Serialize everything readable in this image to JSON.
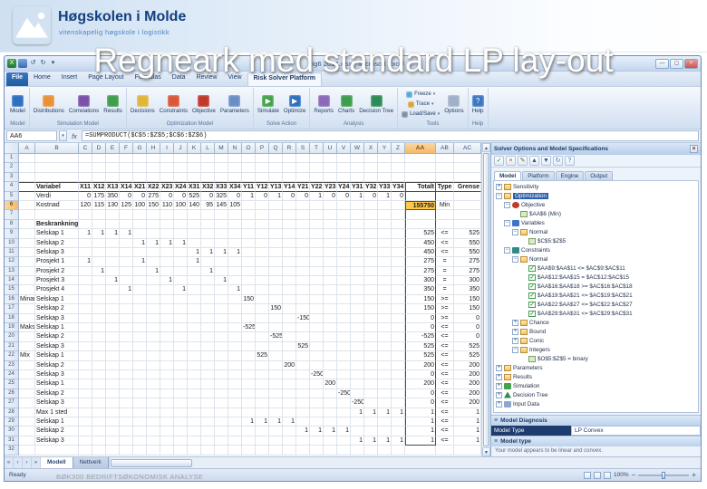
{
  "slide": {
    "title": "Regneark med standard LP lay-out",
    "footer": "BØK300 BEDRIFTSØKONOMISK ANALYSE",
    "logo_title": "Høgskolen i Molde",
    "logo_subtitle": "vitenskapelig høgskole i logistikk"
  },
  "window": {
    "caption": "Fig6 2014.xlsx - Microsoft Excel",
    "name_box": "AA6",
    "formula": "=SUMPRODUCT($C$5:$Z$5;$C$6:$Z$6)",
    "ribbon_tabs": [
      {
        "label": "File",
        "file": true
      },
      {
        "label": "Home"
      },
      {
        "label": "Insert"
      },
      {
        "label": "Page Layout"
      },
      {
        "label": "Formulas"
      },
      {
        "label": "Data"
      },
      {
        "label": "Review"
      },
      {
        "label": "View"
      },
      {
        "label": "Risk Solver Platform",
        "active": true
      }
    ],
    "ribbon_groups": [
      {
        "label": "Model",
        "buttons": [
          {
            "label": "Model",
            "icon": "model",
            "big": true
          }
        ]
      },
      {
        "label": "Simulation Model",
        "buttons": [
          {
            "label": "Distributions",
            "icon": "distributions",
            "big": true
          },
          {
            "label": "Correlations",
            "icon": "correlations",
            "big": true
          },
          {
            "label": "Results",
            "icon": "results",
            "big": true
          }
        ]
      },
      {
        "label": "Optimization Model",
        "buttons": [
          {
            "label": "Decisions",
            "icon": "decisions",
            "big": true
          },
          {
            "label": "Constraints",
            "icon": "constraints",
            "big": true
          },
          {
            "label": "Objective",
            "icon": "objective",
            "big": true
          },
          {
            "label": "Parameters",
            "icon": "parameters",
            "big": true
          }
        ]
      },
      {
        "label": "Solve Action",
        "buttons": [
          {
            "label": "Simulate",
            "icon": "simulate",
            "big": true
          },
          {
            "label": "Optimize",
            "icon": "optimize",
            "big": true
          }
        ]
      },
      {
        "label": "Analysis",
        "buttons": [
          {
            "label": "Reports",
            "icon": "reports",
            "big": true
          },
          {
            "label": "Charts",
            "icon": "charts",
            "big": true
          },
          {
            "label": "Decision Tree",
            "icon": "decision-tree",
            "big": true
          }
        ]
      },
      {
        "label": "Tools",
        "stacked": [
          {
            "label": "Freeze",
            "icon": "freeze"
          },
          {
            "label": "Trace",
            "icon": "trace"
          },
          {
            "label": "Load/Save",
            "icon": "loadsave"
          }
        ],
        "buttons": [
          {
            "label": "Options",
            "icon": "options",
            "big": true
          }
        ]
      },
      {
        "label": "Help",
        "buttons": [
          {
            "label": "Help",
            "icon": "help",
            "big": true
          }
        ]
      }
    ]
  },
  "sheet": {
    "columns": [
      "A",
      "B",
      "C",
      "D",
      "E",
      "F",
      "G",
      "H",
      "I",
      "J",
      "K",
      "L",
      "M",
      "N",
      "O",
      "P",
      "Q",
      "R",
      "S",
      "T",
      "U",
      "V",
      "W",
      "X",
      "Y",
      "Z",
      "AA",
      "AB",
      "AC"
    ],
    "rows": [
      {
        "n": 1
      },
      {
        "n": 2
      },
      {
        "n": 3
      },
      {
        "n": 4,
        "label": "Variabel",
        "cls": "hdr",
        "cells": [
          [
            0,
            "X11"
          ],
          [
            1,
            "X12"
          ],
          [
            2,
            "X13"
          ],
          [
            3,
            "X14"
          ],
          [
            4,
            "X21"
          ],
          [
            5,
            "X22"
          ],
          [
            6,
            "X23"
          ],
          [
            7,
            "X24"
          ],
          [
            8,
            "X31"
          ],
          [
            9,
            "X32"
          ],
          [
            10,
            "X33"
          ],
          [
            11,
            "X34"
          ],
          [
            12,
            "Y11"
          ],
          [
            13,
            "Y12"
          ],
          [
            14,
            "Y13"
          ],
          [
            15,
            "Y14"
          ],
          [
            16,
            "Y21"
          ],
          [
            17,
            "Y22"
          ],
          [
            18,
            "Y23"
          ],
          [
            19,
            "Y24"
          ],
          [
            20,
            "Y31"
          ],
          [
            21,
            "Y32"
          ],
          [
            22,
            "Y33"
          ],
          [
            23,
            "Y34"
          ]
        ],
        "tot": "Totalt",
        "typ": "Type",
        "grn": "Grense"
      },
      {
        "n": 5,
        "label": "Verdi",
        "cells": [
          [
            0,
            "0"
          ],
          [
            1,
            "175"
          ],
          [
            2,
            "350"
          ],
          [
            3,
            "0"
          ],
          [
            4,
            "0"
          ],
          [
            5,
            "275"
          ],
          [
            6,
            "0"
          ],
          [
            7,
            "0"
          ],
          [
            8,
            "525"
          ],
          [
            9,
            "0"
          ],
          [
            10,
            "325"
          ],
          [
            11,
            "0"
          ],
          [
            12,
            "1"
          ],
          [
            13,
            "0"
          ],
          [
            14,
            "1"
          ],
          [
            15,
            "0"
          ],
          [
            16,
            "0"
          ],
          [
            17,
            "1"
          ],
          [
            18,
            "0"
          ],
          [
            19,
            "0"
          ],
          [
            20,
            "1"
          ],
          [
            21,
            "0"
          ],
          [
            22,
            "1"
          ],
          [
            23,
            "0"
          ]
        ]
      },
      {
        "n": 6,
        "label": "Kostnad",
        "cls": "obj",
        "cells": [
          [
            0,
            "120"
          ],
          [
            1,
            "115"
          ],
          [
            2,
            "130"
          ],
          [
            3,
            "125"
          ],
          [
            4,
            "100"
          ],
          [
            5,
            "150"
          ],
          [
            6,
            "110"
          ],
          [
            7,
            "100"
          ],
          [
            8,
            "140"
          ],
          [
            9,
            "95"
          ],
          [
            10,
            "145"
          ],
          [
            11,
            "105"
          ]
        ],
        "tot": "155750",
        "typ": "Min"
      },
      {
        "n": 7
      },
      {
        "n": 8,
        "label": "Beskrankninger:",
        "cls": "bold"
      },
      {
        "n": 9,
        "label": "Selskap 1",
        "cells": [
          [
            0,
            "1"
          ],
          [
            1,
            "1"
          ],
          [
            2,
            "1"
          ],
          [
            3,
            "1"
          ]
        ],
        "tot": "525",
        "typ": "<=",
        "grn": "525"
      },
      {
        "n": 10,
        "label": "Selskap 2",
        "cells": [
          [
            4,
            "1"
          ],
          [
            5,
            "1"
          ],
          [
            6,
            "1"
          ],
          [
            7,
            "1"
          ]
        ],
        "tot": "450",
        "typ": "<=",
        "grn": "550"
      },
      {
        "n": 11,
        "label": "Selskap 3",
        "cells": [
          [
            8,
            "1"
          ],
          [
            9,
            "1"
          ],
          [
            10,
            "1"
          ],
          [
            11,
            "1"
          ]
        ],
        "tot": "450",
        "typ": "<=",
        "grn": "550"
      },
      {
        "n": 12,
        "label": "Prosjekt 1",
        "cells": [
          [
            0,
            "1"
          ],
          [
            4,
            "1"
          ],
          [
            8,
            "1"
          ]
        ],
        "tot": "275",
        "typ": "=",
        "grn": "275"
      },
      {
        "n": 13,
        "label": "Prosjekt 2",
        "cells": [
          [
            1,
            "1"
          ],
          [
            5,
            "1"
          ],
          [
            9,
            "1"
          ]
        ],
        "tot": "275",
        "typ": "=",
        "grn": "275"
      },
      {
        "n": 14,
        "label": "Prosjekt 3",
        "cells": [
          [
            2,
            "1"
          ],
          [
            6,
            "1"
          ],
          [
            10,
            "1"
          ]
        ],
        "tot": "300",
        "typ": "=",
        "grn": "300"
      },
      {
        "n": 15,
        "label": "Prosjekt 4",
        "cells": [
          [
            3,
            "1"
          ],
          [
            7,
            "1"
          ],
          [
            11,
            "1"
          ]
        ],
        "tot": "350",
        "typ": "=",
        "grn": "350"
      },
      {
        "n": 16,
        "grp": "Minandre",
        "label": "Selskap 1",
        "cells": [
          [
            12,
            "150"
          ]
        ],
        "tot": "150",
        "typ": ">=",
        "grn": "150"
      },
      {
        "n": 17,
        "label": "Selskap 2",
        "cells": [
          [
            14,
            "150"
          ]
        ],
        "tot": "150",
        "typ": ">=",
        "grn": "150"
      },
      {
        "n": 18,
        "label": "Selskap 3",
        "cells": [
          [
            16,
            "-150"
          ]
        ],
        "tot": "0",
        "typ": ">=",
        "grn": "0"
      },
      {
        "n": 19,
        "grp": "Maks",
        "label": "Selskap 1",
        "cells": [
          [
            12,
            "-525"
          ]
        ],
        "tot": "0",
        "typ": "<=",
        "grn": "0"
      },
      {
        "n": 20,
        "label": "Selskap 2",
        "cells": [
          [
            14,
            "-525"
          ]
        ],
        "tot": "-525",
        "typ": "<=",
        "grn": "0"
      },
      {
        "n": 21,
        "label": "Selskap 3",
        "cells": [
          [
            16,
            "525"
          ]
        ],
        "tot": "525",
        "typ": "<=",
        "grn": "525"
      },
      {
        "n": 22,
        "grp": "Mix",
        "label": "Selskap 1",
        "cells": [
          [
            13,
            "525"
          ]
        ],
        "tot": "525",
        "typ": "<=",
        "grn": "525"
      },
      {
        "n": 23,
        "label": "Selskap 2",
        "cells": [
          [
            15,
            "200"
          ]
        ],
        "tot": "200",
        "typ": "<=",
        "grn": "200"
      },
      {
        "n": 24,
        "label": "Selskap 3",
        "cells": [
          [
            17,
            "-250"
          ]
        ],
        "tot": "0",
        "typ": "<=",
        "grn": "200"
      },
      {
        "n": 25,
        "label": "Selskap 1",
        "cells": [
          [
            18,
            "200"
          ]
        ],
        "tot": "200",
        "typ": "<=",
        "grn": "200"
      },
      {
        "n": 26,
        "label": "Selskap 2",
        "cells": [
          [
            19,
            "-250"
          ]
        ],
        "tot": "0",
        "typ": "<=",
        "grn": "200"
      },
      {
        "n": 27,
        "label": "Selskap 3",
        "cells": [
          [
            20,
            "-250"
          ]
        ],
        "tot": "0",
        "typ": "<=",
        "grn": "200"
      },
      {
        "n": 28,
        "label": "Max 1 sted",
        "cells": [
          [
            20,
            "1"
          ],
          [
            21,
            "1"
          ],
          [
            22,
            "1"
          ],
          [
            23,
            "1"
          ]
        ],
        "tot": "1",
        "typ": "<=",
        "grn": "1"
      },
      {
        "n": 29,
        "label": "Selskap 1",
        "cells": [
          [
            12,
            "1"
          ],
          [
            13,
            "1"
          ],
          [
            14,
            "1"
          ],
          [
            15,
            "1"
          ]
        ],
        "tot": "1",
        "typ": "<=",
        "grn": "1"
      },
      {
        "n": 30,
        "label": "Selskap 2",
        "cells": [
          [
            16,
            "1"
          ],
          [
            17,
            "1"
          ],
          [
            18,
            "1"
          ],
          [
            19,
            "1"
          ]
        ],
        "tot": "1",
        "typ": "<=",
        "grn": "1"
      },
      {
        "n": 31,
        "label": "Selskap 3",
        "cells": [
          [
            20,
            "1"
          ],
          [
            21,
            "1"
          ],
          [
            22,
            "1"
          ],
          [
            23,
            "1"
          ]
        ],
        "tot": "1",
        "typ": "<=",
        "grn": "1"
      },
      {
        "n": 32
      }
    ]
  },
  "pane": {
    "title": "Solver Options and Model Specifications",
    "toolbar": [
      {
        "name": "accept",
        "glyph": "✓",
        "color": "#2e8b2e"
      },
      {
        "name": "delete",
        "glyph": "×",
        "color": "#c0392b"
      },
      {
        "name": "edit",
        "glyph": "✎",
        "color": "#6b5b2e"
      },
      {
        "name": "move-up",
        "glyph": "▲",
        "color": "#39537a"
      },
      {
        "name": "move-down",
        "glyph": "▼",
        "color": "#39537a"
      },
      {
        "name": "refresh",
        "glyph": "↻",
        "color": "#2e6fc0"
      },
      {
        "name": "help",
        "glyph": "?",
        "color": "#3a76c4"
      }
    ],
    "tabs": [
      {
        "label": "Model",
        "active": true
      },
      {
        "label": "Platform"
      },
      {
        "label": "Engine"
      },
      {
        "label": "Output"
      }
    ],
    "tree": [
      {
        "d": 0,
        "icon": "folder",
        "label": "Sensitivity",
        "exp": "+"
      },
      {
        "d": 0,
        "icon": "folder",
        "label": "Optimization",
        "exp": "-",
        "sel": true
      },
      {
        "d": 1,
        "icon": "objective",
        "label": "Objective",
        "exp": "-"
      },
      {
        "d": 2,
        "icon": "cell",
        "label": "$AA$6 (Min)"
      },
      {
        "d": 1,
        "icon": "variables",
        "label": "Variables",
        "exp": "-"
      },
      {
        "d": 2,
        "icon": "folder",
        "label": "Normal",
        "exp": "-"
      },
      {
        "d": 3,
        "icon": "cell",
        "label": "$C$5:$Z$5"
      },
      {
        "d": 1,
        "icon": "constraints",
        "label": "Constraints",
        "exp": "-"
      },
      {
        "d": 2,
        "icon": "folder",
        "label": "Normal",
        "exp": "-"
      },
      {
        "d": 3,
        "icon": "check",
        "label": "$AA$9:$AA$11 <= $AC$9:$AC$11"
      },
      {
        "d": 3,
        "icon": "check",
        "label": "$AA$12:$AA$15 = $AC$12:$AC$15"
      },
      {
        "d": 3,
        "icon": "check",
        "label": "$AA$16:$AA$18 >= $AC$16:$AC$18"
      },
      {
        "d": 3,
        "icon": "check",
        "label": "$AA$19:$AA$21 <= $AC$19:$AC$21"
      },
      {
        "d": 3,
        "icon": "check",
        "label": "$AA$22:$AA$27 <= $AC$22:$AC$27"
      },
      {
        "d": 3,
        "icon": "check",
        "label": "$AA$29:$AA$31 <= $AC$29:$AC$31"
      },
      {
        "d": 2,
        "icon": "folder",
        "label": "Chance",
        "exp": "+"
      },
      {
        "d": 2,
        "icon": "folder",
        "label": "Bound",
        "exp": "+"
      },
      {
        "d": 2,
        "icon": "folder",
        "label": "Conic",
        "exp": "+"
      },
      {
        "d": 2,
        "icon": "folder",
        "label": "Integers",
        "exp": "-"
      },
      {
        "d": 3,
        "icon": "cell",
        "label": "$O$5:$Z$5 = binary"
      },
      {
        "d": 0,
        "icon": "folder",
        "label": "Parameters",
        "exp": "+"
      },
      {
        "d": 0,
        "icon": "folder",
        "label": "Results",
        "exp": "+"
      },
      {
        "d": 0,
        "icon": "sim",
        "label": "Simulation",
        "exp": "+"
      },
      {
        "d": 0,
        "icon": "tree",
        "label": "Decision Tree",
        "exp": "+"
      },
      {
        "d": 0,
        "icon": "data",
        "label": "Input Data",
        "exp": "+"
      }
    ],
    "diagnosis": {
      "header": "Model Diagnosis",
      "type_label": "Model Type",
      "type_value": "LP Convex",
      "section2": "Model type",
      "help": "Your model appears to be linear and convex."
    }
  },
  "status": {
    "ready": "Ready",
    "zoom": "100%",
    "sheet_tabs": [
      {
        "label": "Modell",
        "active": true
      },
      {
        "label": "Nettverk",
        "active": false
      }
    ]
  }
}
